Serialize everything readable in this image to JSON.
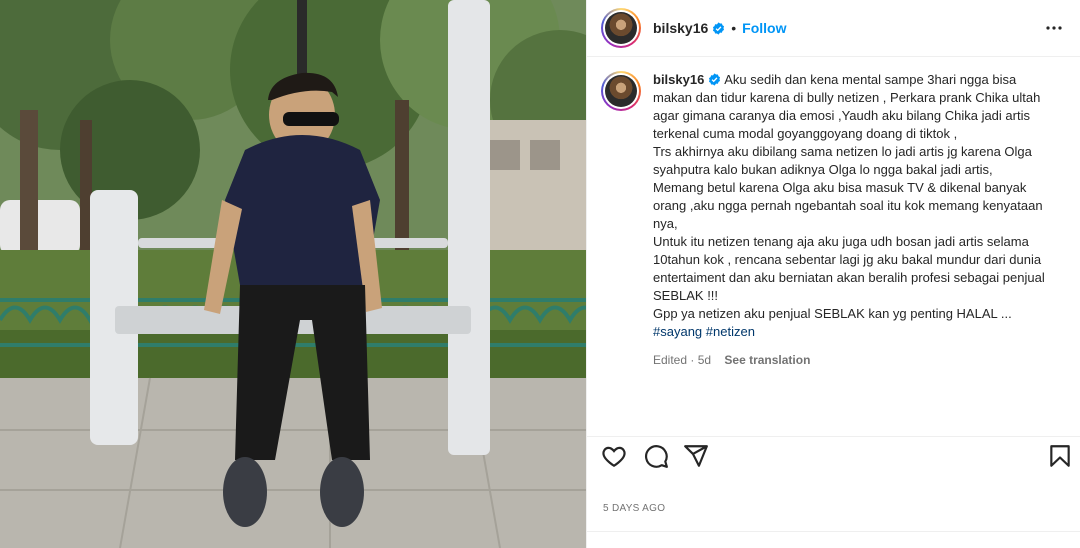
{
  "post": {
    "photo_alt": "",
    "author": {
      "username": "bilsky16",
      "verified": true,
      "follow_label": "Follow",
      "separator": "•"
    },
    "caption": {
      "username": "bilsky16",
      "text": " Aku sedih dan kena mental sampe 3hari ngga bisa makan dan tidur karena di bully netizen , Perkara prank Chika ultah agar gimana caranya dia emosi ,Yaudh aku bilang Chika jadi artis terkenal cuma modal goyanggoyang doang di tiktok ,\nTrs akhirnya aku dibilang sama netizen lo jadi artis jg karena Olga syahputra kalo bukan adiknya Olga lo ngga bakal jadi artis,\nMemang betul karena Olga aku bisa masuk TV & dikenal banyak orang ,aku ngga pernah ngebantah soal itu kok memang kenyataan nya,\nUntuk itu netizen tenang aja aku juga udh bosan jadi artis selama 10tahun kok , rencana sebentar lagi jg aku bakal mundur dari dunia entertaiment dan aku berniatan akan beralih profesi sebagai penjual SEBLAK !!!\nGpp ya netizen aku penjual SEBLAK kan yg penting HALAL ...",
      "hashtags": [
        "#sayang",
        "#netizen"
      ],
      "edited_label": "Edited · 5d",
      "see_translation": "See translation"
    },
    "actions": {
      "like_icon": "heart-icon",
      "comment_icon": "comment-icon",
      "share_icon": "share-icon",
      "save_icon": "bookmark-icon"
    },
    "timestamp": "5 DAYS AGO"
  },
  "colors": {
    "accent": "#0095f6",
    "hashtag": "#00376b",
    "muted": "#737373",
    "text": "#262626",
    "divider": "#efefef"
  }
}
